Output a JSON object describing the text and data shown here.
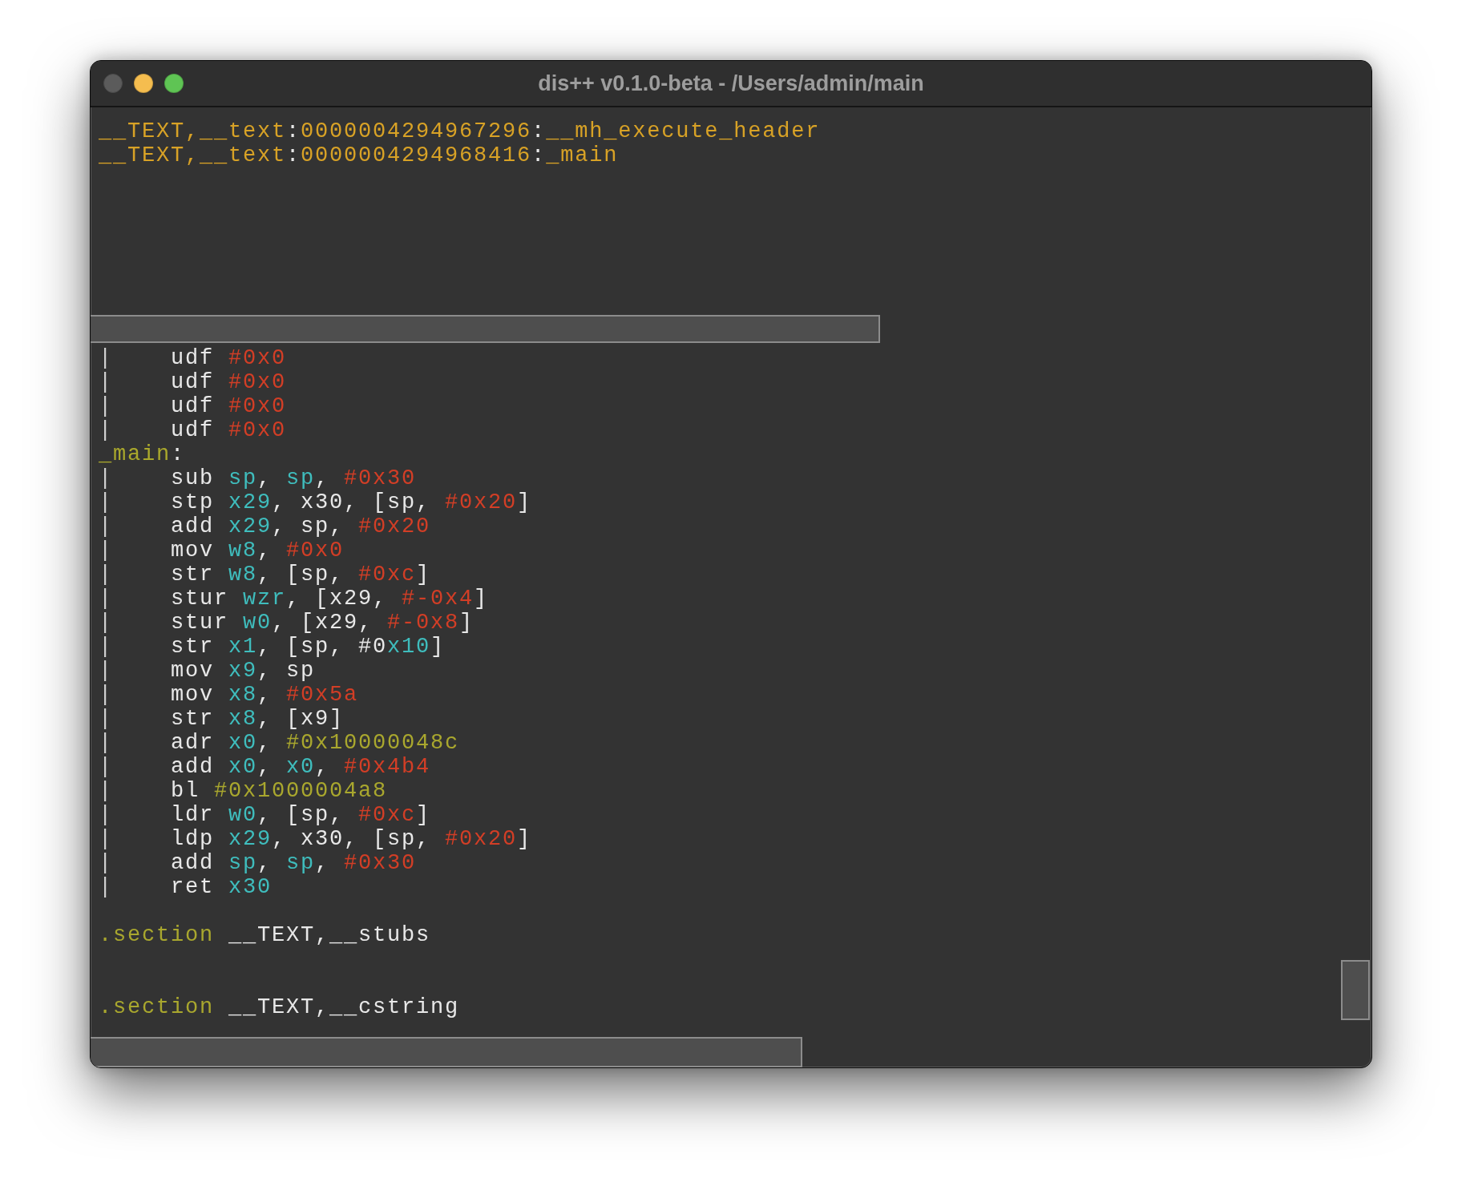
{
  "window": {
    "title": "dis++ v0.1.0-beta - /Users/admin/main",
    "controls": [
      {
        "kind": "close",
        "disabled": true
      },
      {
        "kind": "minimize",
        "disabled": false
      },
      {
        "kind": "zoom",
        "disabled": false
      }
    ]
  },
  "symbol_list": {
    "lines": [
      {
        "tokens": [
          {
            "text": "__TEXT,__text",
            "kind": "symbol"
          },
          {
            "text": ":",
            "kind": "separator"
          },
          {
            "text": "0000004294967296",
            "kind": "symbol"
          },
          {
            "text": ":",
            "kind": "separator"
          },
          {
            "text": "__mh_execute_header",
            "kind": "symbol"
          }
        ]
      },
      {
        "tokens": [
          {
            "text": "__TEXT,__text",
            "kind": "symbol"
          },
          {
            "text": ":",
            "kind": "separator"
          },
          {
            "text": "0000004294968416",
            "kind": "symbol"
          },
          {
            "text": ":",
            "kind": "separator"
          },
          {
            "text": "_main",
            "kind": "symbol"
          }
        ]
      }
    ]
  },
  "disassembly": {
    "lines": [
      {
        "kind": "code",
        "tokens": [
          {
            "text": "|    ",
            "kind": "gutter"
          },
          {
            "text": "udf ",
            "kind": "plain"
          },
          {
            "text": "#0x0",
            "kind": "immediate"
          }
        ]
      },
      {
        "kind": "code",
        "tokens": [
          {
            "text": "|    ",
            "kind": "gutter"
          },
          {
            "text": "udf ",
            "kind": "plain"
          },
          {
            "text": "#0x0",
            "kind": "immediate"
          }
        ]
      },
      {
        "kind": "code",
        "tokens": [
          {
            "text": "|    ",
            "kind": "gutter"
          },
          {
            "text": "udf ",
            "kind": "plain"
          },
          {
            "text": "#0x0",
            "kind": "immediate"
          }
        ]
      },
      {
        "kind": "code",
        "tokens": [
          {
            "text": "|    ",
            "kind": "gutter"
          },
          {
            "text": "udf ",
            "kind": "plain"
          },
          {
            "text": "#0x0",
            "kind": "immediate"
          }
        ]
      },
      {
        "kind": "code",
        "tokens": [
          {
            "text": "_main",
            "kind": "label"
          },
          {
            "text": ":",
            "kind": "plain"
          }
        ]
      },
      {
        "kind": "code",
        "tokens": [
          {
            "text": "|    ",
            "kind": "gutter"
          },
          {
            "text": "sub ",
            "kind": "plain"
          },
          {
            "text": "sp",
            "kind": "register"
          },
          {
            "text": ", ",
            "kind": "plain"
          },
          {
            "text": "sp",
            "kind": "register"
          },
          {
            "text": ", ",
            "kind": "plain"
          },
          {
            "text": "#0x30",
            "kind": "immediate"
          }
        ]
      },
      {
        "kind": "code",
        "tokens": [
          {
            "text": "|    ",
            "kind": "gutter"
          },
          {
            "text": "stp ",
            "kind": "plain"
          },
          {
            "text": "x29",
            "kind": "register"
          },
          {
            "text": ", x30, [sp, ",
            "kind": "plain"
          },
          {
            "text": "#0x20",
            "kind": "immediate"
          },
          {
            "text": "]",
            "kind": "plain"
          }
        ]
      },
      {
        "kind": "code",
        "tokens": [
          {
            "text": "|    ",
            "kind": "gutter"
          },
          {
            "text": "add ",
            "kind": "plain"
          },
          {
            "text": "x29",
            "kind": "register"
          },
          {
            "text": ", sp, ",
            "kind": "plain"
          },
          {
            "text": "#0x20",
            "kind": "immediate"
          }
        ]
      },
      {
        "kind": "code",
        "tokens": [
          {
            "text": "|    ",
            "kind": "gutter"
          },
          {
            "text": "mov ",
            "kind": "plain"
          },
          {
            "text": "w8",
            "kind": "register"
          },
          {
            "text": ", ",
            "kind": "plain"
          },
          {
            "text": "#0x0",
            "kind": "immediate"
          }
        ]
      },
      {
        "kind": "code",
        "tokens": [
          {
            "text": "|    ",
            "kind": "gutter"
          },
          {
            "text": "str ",
            "kind": "plain"
          },
          {
            "text": "w8",
            "kind": "register"
          },
          {
            "text": ", [sp, ",
            "kind": "plain"
          },
          {
            "text": "#0xc",
            "kind": "immediate"
          },
          {
            "text": "]",
            "kind": "plain"
          }
        ]
      },
      {
        "kind": "code",
        "tokens": [
          {
            "text": "|    ",
            "kind": "gutter"
          },
          {
            "text": "stur ",
            "kind": "plain"
          },
          {
            "text": "wzr",
            "kind": "register"
          },
          {
            "text": ", [x29, ",
            "kind": "plain"
          },
          {
            "text": "#-0x4",
            "kind": "immediate"
          },
          {
            "text": "]",
            "kind": "plain"
          }
        ]
      },
      {
        "kind": "code",
        "tokens": [
          {
            "text": "|    ",
            "kind": "gutter"
          },
          {
            "text": "stur ",
            "kind": "plain"
          },
          {
            "text": "w0",
            "kind": "register"
          },
          {
            "text": ", [x29, ",
            "kind": "plain"
          },
          {
            "text": "#-0x8",
            "kind": "immediate"
          },
          {
            "text": "]",
            "kind": "plain"
          }
        ]
      },
      {
        "kind": "code",
        "tokens": [
          {
            "text": "|    ",
            "kind": "gutter"
          },
          {
            "text": "str ",
            "kind": "plain"
          },
          {
            "text": "x1",
            "kind": "register"
          },
          {
            "text": ", [sp, #0",
            "kind": "plain"
          },
          {
            "text": "x10",
            "kind": "register"
          },
          {
            "text": "]",
            "kind": "plain"
          }
        ]
      },
      {
        "kind": "code",
        "tokens": [
          {
            "text": "|    ",
            "kind": "gutter"
          },
          {
            "text": "mov ",
            "kind": "plain"
          },
          {
            "text": "x9",
            "kind": "register"
          },
          {
            "text": ", sp",
            "kind": "plain"
          }
        ]
      },
      {
        "kind": "code",
        "tokens": [
          {
            "text": "|    ",
            "kind": "gutter"
          },
          {
            "text": "mov ",
            "kind": "plain"
          },
          {
            "text": "x8",
            "kind": "register"
          },
          {
            "text": ", ",
            "kind": "plain"
          },
          {
            "text": "#0x5a",
            "kind": "immediate"
          }
        ]
      },
      {
        "kind": "code",
        "tokens": [
          {
            "text": "|    ",
            "kind": "gutter"
          },
          {
            "text": "str ",
            "kind": "plain"
          },
          {
            "text": "x8",
            "kind": "register"
          },
          {
            "text": ", [x9]",
            "kind": "plain"
          }
        ]
      },
      {
        "kind": "code",
        "tokens": [
          {
            "text": "|    ",
            "kind": "gutter"
          },
          {
            "text": "adr ",
            "kind": "plain"
          },
          {
            "text": "x0",
            "kind": "register"
          },
          {
            "text": ", ",
            "kind": "plain"
          },
          {
            "text": "#0x10000048c",
            "kind": "address"
          }
        ]
      },
      {
        "kind": "code",
        "tokens": [
          {
            "text": "|    ",
            "kind": "gutter"
          },
          {
            "text": "add ",
            "kind": "plain"
          },
          {
            "text": "x0",
            "kind": "register"
          },
          {
            "text": ", ",
            "kind": "plain"
          },
          {
            "text": "x0",
            "kind": "register"
          },
          {
            "text": ", ",
            "kind": "plain"
          },
          {
            "text": "#0x4b4",
            "kind": "immediate"
          }
        ]
      },
      {
        "kind": "code",
        "tokens": [
          {
            "text": "|    ",
            "kind": "gutter"
          },
          {
            "text": "bl ",
            "kind": "plain"
          },
          {
            "text": "#0x1000004a8",
            "kind": "address"
          }
        ]
      },
      {
        "kind": "code",
        "tokens": [
          {
            "text": "|    ",
            "kind": "gutter"
          },
          {
            "text": "ldr ",
            "kind": "plain"
          },
          {
            "text": "w0",
            "kind": "register"
          },
          {
            "text": ", [sp, ",
            "kind": "plain"
          },
          {
            "text": "#0xc",
            "kind": "immediate"
          },
          {
            "text": "]",
            "kind": "plain"
          }
        ]
      },
      {
        "kind": "code",
        "tokens": [
          {
            "text": "|    ",
            "kind": "gutter"
          },
          {
            "text": "ldp ",
            "kind": "plain"
          },
          {
            "text": "x29",
            "kind": "register"
          },
          {
            "text": ", x30, [sp, ",
            "kind": "plain"
          },
          {
            "text": "#0x20",
            "kind": "immediate"
          },
          {
            "text": "]",
            "kind": "plain"
          }
        ]
      },
      {
        "kind": "code",
        "tokens": [
          {
            "text": "|    ",
            "kind": "gutter"
          },
          {
            "text": "add ",
            "kind": "plain"
          },
          {
            "text": "sp",
            "kind": "register"
          },
          {
            "text": ", ",
            "kind": "plain"
          },
          {
            "text": "sp",
            "kind": "register"
          },
          {
            "text": ", ",
            "kind": "plain"
          },
          {
            "text": "#0x30",
            "kind": "immediate"
          }
        ]
      },
      {
        "kind": "code",
        "tokens": [
          {
            "text": "|    ",
            "kind": "gutter"
          },
          {
            "text": "ret ",
            "kind": "plain"
          },
          {
            "text": "x30",
            "kind": "register"
          }
        ]
      },
      {
        "kind": "blank"
      },
      {
        "kind": "code",
        "tokens": [
          {
            "text": ".section ",
            "kind": "directive"
          },
          {
            "text": "__TEXT,__stubs",
            "kind": "plain"
          }
        ]
      },
      {
        "kind": "blank"
      },
      {
        "kind": "blank"
      },
      {
        "kind": "code",
        "tokens": [
          {
            "text": ".section ",
            "kind": "directive"
          },
          {
            "text": "__TEXT,__cstring",
            "kind": "plain"
          }
        ]
      }
    ]
  }
}
